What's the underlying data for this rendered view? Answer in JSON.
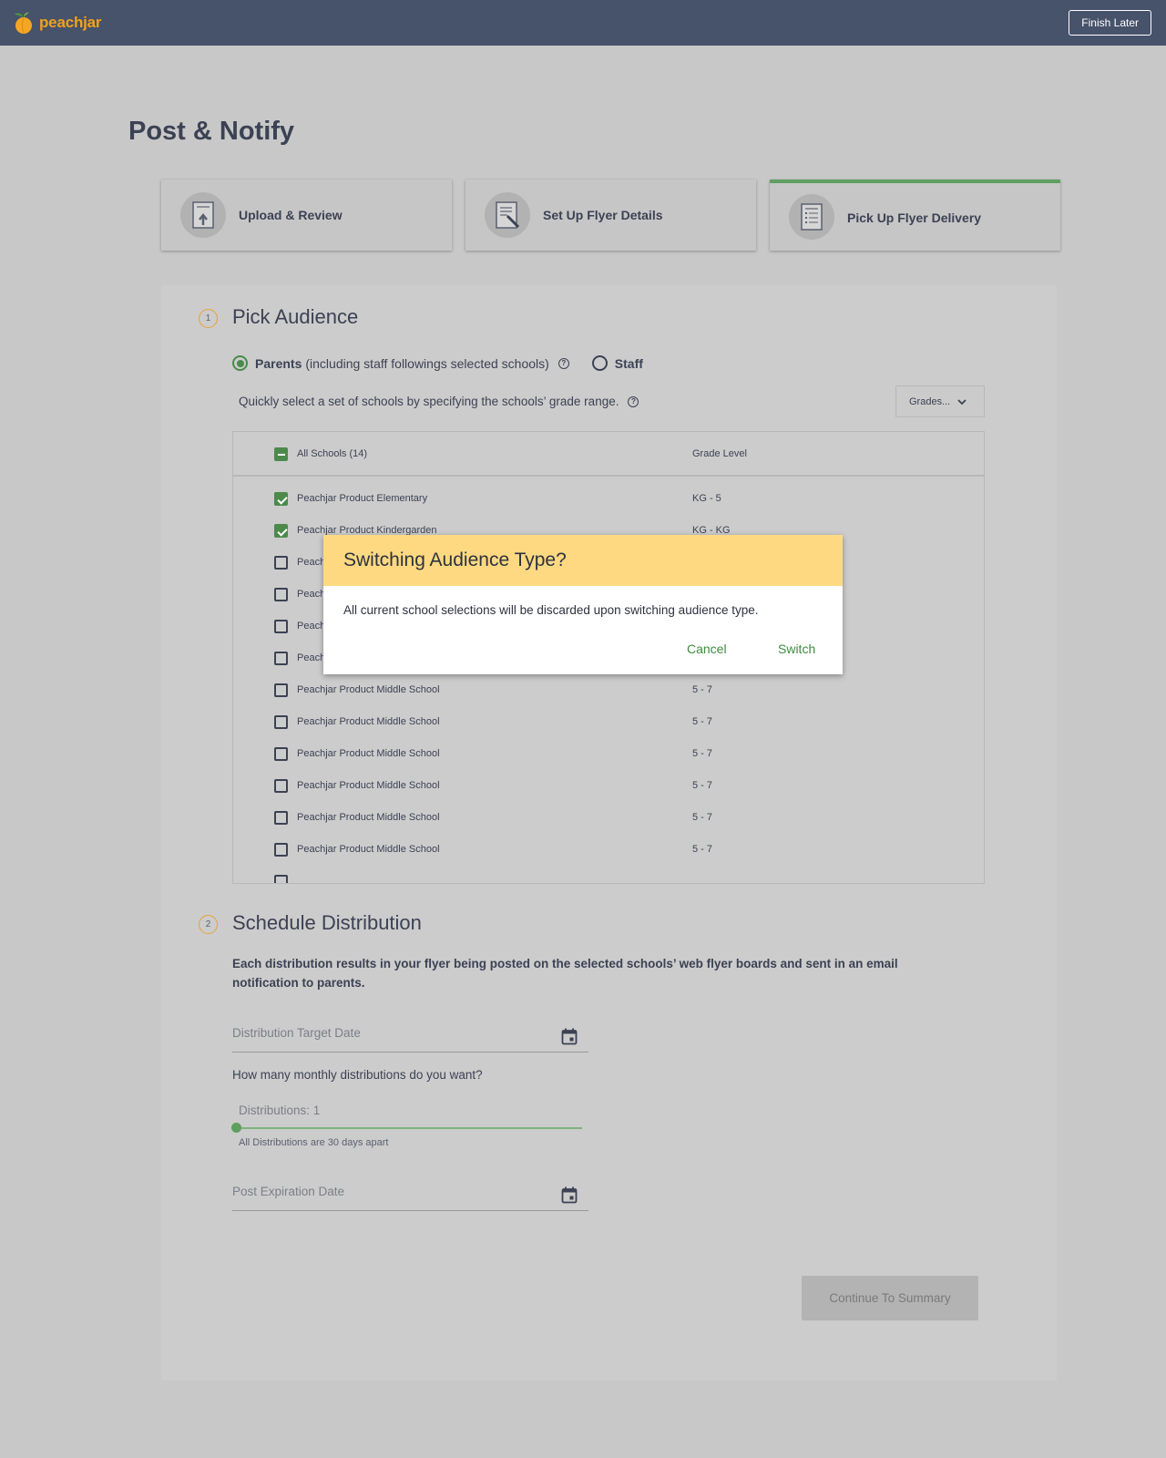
{
  "app": {
    "logo_text": "peachjar",
    "finish_later": "Finish Later"
  },
  "page": {
    "title": "Post & Notify"
  },
  "steps": [
    {
      "label": "Upload & Review",
      "icon": "upload-document-icon",
      "active": false
    },
    {
      "label": "Set Up Flyer Details",
      "icon": "edit-document-icon",
      "active": false
    },
    {
      "label": "Pick Up Flyer Delivery",
      "icon": "list-document-icon",
      "active": true
    }
  ],
  "audience": {
    "number": "1",
    "title": "Pick Audience",
    "parents_label": "Parents",
    "parents_note": "(including staff followings selected schools)",
    "staff_label": "Staff",
    "selected": "Parents",
    "quick_select_text": "Quickly select a set of schools by specifying the schools’ grade range.",
    "grades_placeholder": "Grades...",
    "table": {
      "all_schools_label": "All Schools (14)",
      "grade_level_header": "Grade Level",
      "rows": [
        {
          "name": "Peachjar Product Elementary",
          "grade": "KG - 5",
          "checked": true
        },
        {
          "name": "Peachjar Product Kindergarden",
          "grade": "KG - KG",
          "checked": true
        },
        {
          "name": "Peach",
          "grade": "",
          "checked": false
        },
        {
          "name": "Peach",
          "grade": "",
          "checked": false
        },
        {
          "name": "Peach",
          "grade": "",
          "checked": false
        },
        {
          "name": "Peach",
          "grade": "",
          "checked": false
        },
        {
          "name": "Peachjar Product Middle School",
          "grade": "5 - 7",
          "checked": false
        },
        {
          "name": "Peachjar Product Middle School",
          "grade": "5 - 7",
          "checked": false
        },
        {
          "name": "Peachjar Product Middle School",
          "grade": "5 - 7",
          "checked": false
        },
        {
          "name": "Peachjar Product Middle School",
          "grade": "5 - 7",
          "checked": false
        },
        {
          "name": "Peachjar Product Middle School",
          "grade": "5 - 7",
          "checked": false
        },
        {
          "name": "Peachjar Product Middle School",
          "grade": "5 - 7",
          "checked": false
        }
      ]
    }
  },
  "schedule": {
    "number": "2",
    "title": "Schedule Distribution",
    "description": "Each distribution results in your flyer being posted on the selected schools’ web flyer boards and sent in an email notification to parents.",
    "target_date_placeholder": "Distribution Target Date",
    "question": "How many monthly distributions do you want?",
    "distributions_label": "Distributions: 1",
    "distributions_value": 1,
    "slider_note": "All Distributions are 30 days apart",
    "expiration_placeholder": "Post Expiration Date",
    "continue_label": "Continue To Summary"
  },
  "modal": {
    "title": "Switching Audience Type?",
    "body": "All current school selections will be discarded upon switching audience type.",
    "cancel_label": "Cancel",
    "switch_label": "Switch"
  },
  "colors": {
    "topbar": "#47526b",
    "brand_orange": "#f0a21a",
    "accent_green": "#4c8a4c",
    "modal_header": "#fed981",
    "section_badge": "#e8a23a"
  }
}
